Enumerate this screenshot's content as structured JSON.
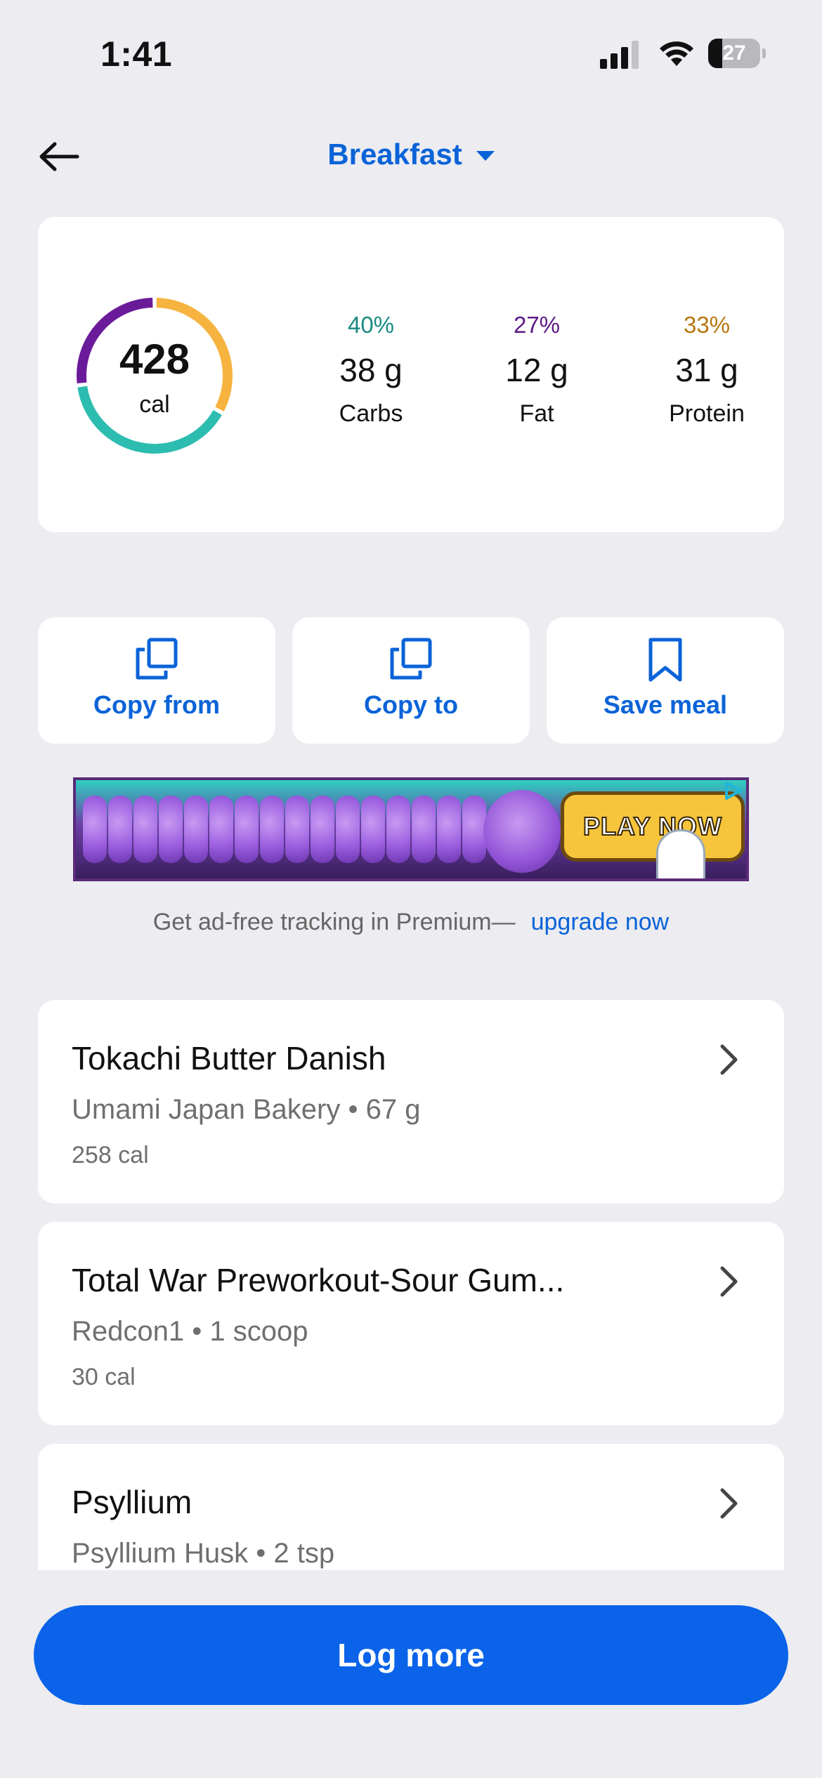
{
  "status_bar": {
    "time": "1:41",
    "battery_level": "27",
    "battery_fraction": 0.27
  },
  "header": {
    "back_icon": "arrow-left-icon",
    "meal_title": "Breakfast",
    "dropdown_icon": "caret-down-icon"
  },
  "summary": {
    "calories": "428",
    "calories_unit": "cal",
    "ring_colors": {
      "carbs": "#2dbdb0",
      "fat": "#6a1b9a",
      "protein": "#f6b340"
    },
    "macros": [
      {
        "percent": "40%",
        "percent_value": 0.4,
        "grams": "38 g",
        "name": "Carbs",
        "color": "#1a8a80"
      },
      {
        "percent": "27%",
        "percent_value": 0.27,
        "grams": "12 g",
        "name": "Fat",
        "color": "#5e1a87"
      },
      {
        "percent": "33%",
        "percent_value": 0.33,
        "grams": "31 g",
        "name": "Protein",
        "color": "#b8760d"
      }
    ]
  },
  "actions": [
    {
      "label": "Copy from",
      "icon": "copy-icon"
    },
    {
      "label": "Copy to",
      "icon": "copy-icon"
    },
    {
      "label": "Save meal",
      "icon": "bookmark-icon"
    }
  ],
  "ad": {
    "cta": "PLAY NOW"
  },
  "premium": {
    "text": "Get ad-free tracking in Premium—",
    "link": "upgrade now"
  },
  "foods": [
    {
      "name": "Tokachi Butter Danish",
      "detail": "Umami Japan Bakery • 67 g",
      "calories": "258 cal"
    },
    {
      "name": "Total War Preworkout-Sour Gum...",
      "detail": "Redcon1 • 1 scoop",
      "calories": "30 cal"
    },
    {
      "name": "Psyllium",
      "detail": "Psyllium Husk • 2 tsp",
      "calories": ""
    }
  ],
  "footer": {
    "log_more": "Log more"
  },
  "colors": {
    "accent": "#0a63d8",
    "background": "#ececf1"
  }
}
